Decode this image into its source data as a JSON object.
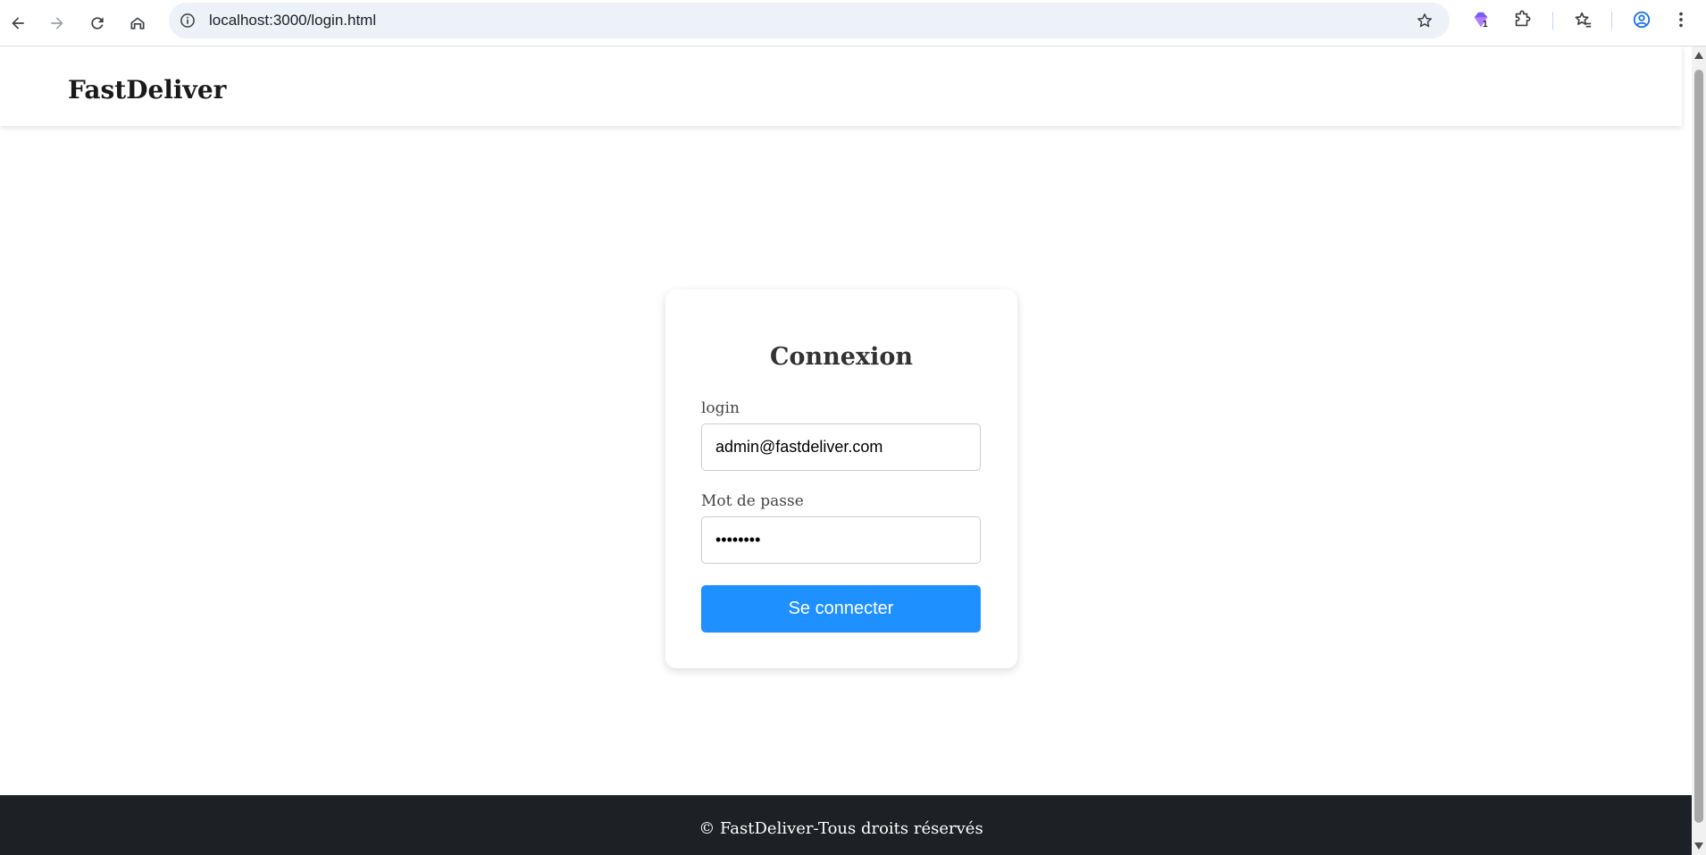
{
  "browser": {
    "url": "localhost:3000/login.html",
    "extension_badge": "1"
  },
  "header": {
    "brand": "FastDeliver"
  },
  "login_form": {
    "title": "Connexion",
    "login_label": "login",
    "login_value": "admin@fastdeliver.com",
    "password_label": "Mot de passe",
    "password_value": "fastpass",
    "submit_label": "Se connecter"
  },
  "footer": {
    "text": "© FastDeliver-Tous droits réservés"
  },
  "colors": {
    "primary_button": "#1e90ff",
    "footer_bg": "#1d2125",
    "omnibox_bg": "#edf1f8"
  }
}
